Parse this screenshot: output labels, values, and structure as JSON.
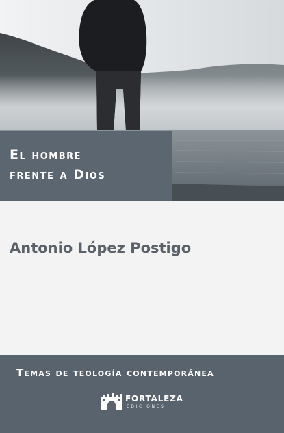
{
  "cover": {
    "title_line1": "El hombre",
    "title_line2": "frente a Dios",
    "author": "Antonio López Postigo",
    "series": "Temas de teología contemporánea",
    "publisher_name": "FORTALEZA",
    "publisher_sub": "EDICIONES"
  },
  "colors": {
    "title_band": "#5c6670",
    "footer_band": "#59636d",
    "author_text": "#5a6169",
    "background": "#f3f3f4"
  },
  "icons": {
    "publisher_logo": "fortaleza-castle-icon"
  }
}
